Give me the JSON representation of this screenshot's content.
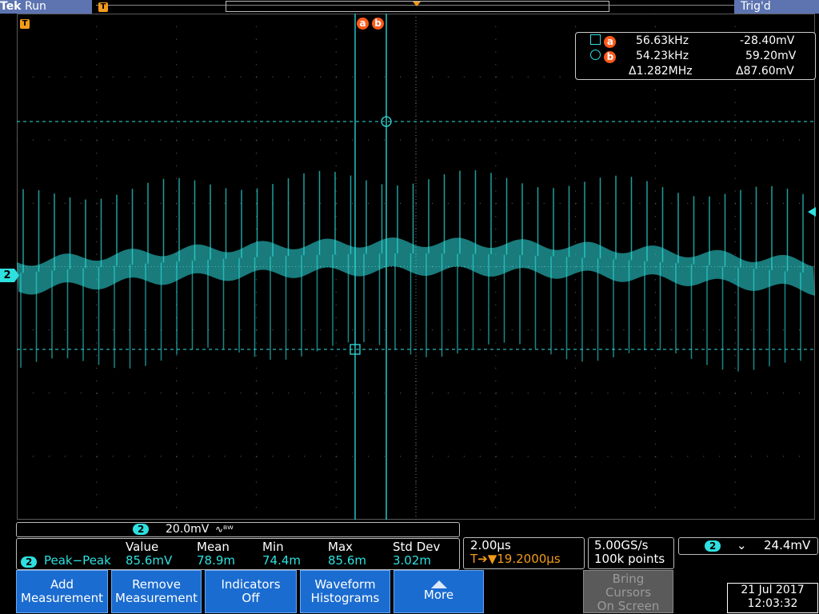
{
  "header": {
    "brand": "Tek",
    "run_state": "Run",
    "trigger_status": "Trig'd",
    "trigger_marker": "T"
  },
  "cursors": {
    "a_label": "a",
    "b_label": "b",
    "a_freq": "56.63kHz",
    "a_volt": "-28.40mV",
    "b_freq": "54.23kHz",
    "b_volt": "59.20mV",
    "delta_freq": "Δ1.282MHz",
    "delta_volt": "Δ87.60mV"
  },
  "channel": {
    "number": "2",
    "scale": "20.0mV",
    "bandwidth_symbol": "∿ᴮᵂ",
    "color": "#2ee0e0"
  },
  "measurement": {
    "name": "Peak−Peak",
    "headers": [
      "Value",
      "Mean",
      "Min",
      "Max",
      "Std Dev"
    ],
    "values": [
      "85.6mV",
      "78.9m",
      "74.4m",
      "85.6m",
      "3.02m"
    ]
  },
  "timebase": {
    "time_per_div": "2.00µs",
    "delay": "T➔▼19.2000µs"
  },
  "acquisition": {
    "sample_rate": "5.00GS/s",
    "record_length": "100k points"
  },
  "trigger": {
    "channel": "2",
    "slope": "⌄",
    "level": "24.4mV"
  },
  "buttons": {
    "add_measurement": [
      "Add",
      "Measurement"
    ],
    "remove_measurement": [
      "Remove",
      "Measurement"
    ],
    "indicators": [
      "Indicators",
      "Off"
    ],
    "waveform_histograms": [
      "Waveform",
      "Histograms"
    ],
    "more": "More",
    "bring_cursors": [
      "Bring",
      "Cursors",
      "On Screen"
    ]
  },
  "datetime": {
    "date": "21 Jul  2017",
    "time": "12:03:32"
  }
}
